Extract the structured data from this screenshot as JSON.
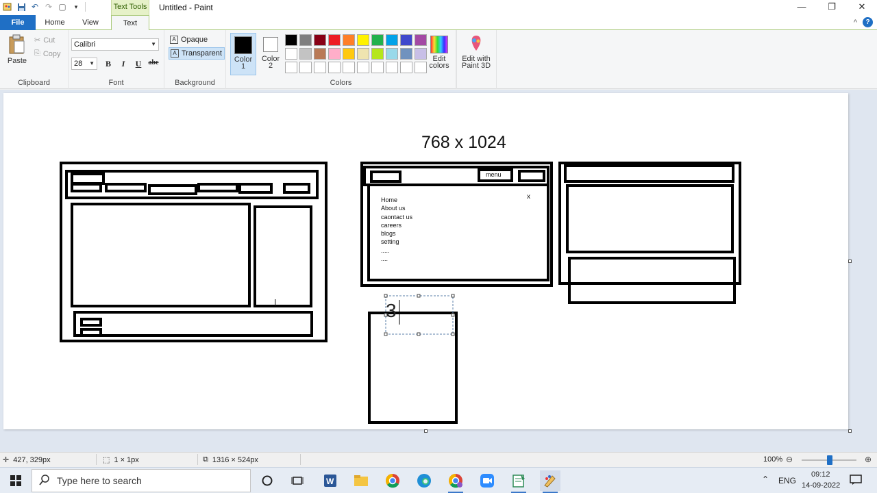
{
  "window": {
    "title": "Untitled - Paint",
    "contextual_tab": "Text Tools",
    "controls": {
      "minimize": "—",
      "restore": "❐",
      "close": "✕"
    }
  },
  "tabs": {
    "file": "File",
    "home": "Home",
    "view": "View",
    "text": "Text"
  },
  "help": {
    "collapse": "^",
    "help": "?"
  },
  "ribbon": {
    "clipboard": {
      "paste": "Paste",
      "cut": "Cut",
      "copy": "Copy",
      "label": "Clipboard"
    },
    "font": {
      "family": "Calibri",
      "size": "28",
      "bold": "B",
      "italic": "I",
      "underline": "U",
      "strike": "abc",
      "label": "Font"
    },
    "background": {
      "opaque": "Opaque",
      "transparent": "Transparent",
      "label": "Background"
    },
    "colors": {
      "color1_label": "Color\n1",
      "color1_l1": "Color",
      "color1_l2": "1",
      "color2_l1": "Color",
      "color2_l2": "2",
      "edit_l1": "Edit",
      "edit_l2": "colors",
      "paint3d_l1": "Edit with",
      "paint3d_l2": "Paint 3D",
      "label": "Colors",
      "color1": "#000000",
      "color2": "#ffffff",
      "palette": [
        "#000000",
        "#7f7f7f",
        "#880015",
        "#ed1c24",
        "#ff7f27",
        "#fff200",
        "#22b14c",
        "#00a2e8",
        "#3f48cc",
        "#a349a4",
        "#ffffff",
        "#c3c3c3",
        "#b97a57",
        "#ffaec9",
        "#ffc90e",
        "#efe4b0",
        "#b5e61d",
        "#99d9ea",
        "#7092be",
        "#c8bfe7",
        "#ffffff",
        "#ffffff",
        "#ffffff",
        "#ffffff",
        "#ffffff",
        "#ffffff",
        "#ffffff",
        "#ffffff",
        "#ffffff",
        "#ffffff"
      ]
    }
  },
  "canvas": {
    "heading": "768 x 1024",
    "menu_button": "menu",
    "close_x": "x",
    "menu_items": [
      "Home",
      "About us",
      "caontact us",
      "careers",
      "blogs",
      "setting",
      ".....",
      "...."
    ],
    "typed_text": "3"
  },
  "status": {
    "cursor": "427, 329px",
    "selection": "1 × 1px",
    "size": "1316 × 524px",
    "zoom": "100%"
  },
  "taskbar": {
    "search_placeholder": "Type here to search",
    "lang": "ENG",
    "time": "09:12",
    "date": "14-09-2022"
  }
}
